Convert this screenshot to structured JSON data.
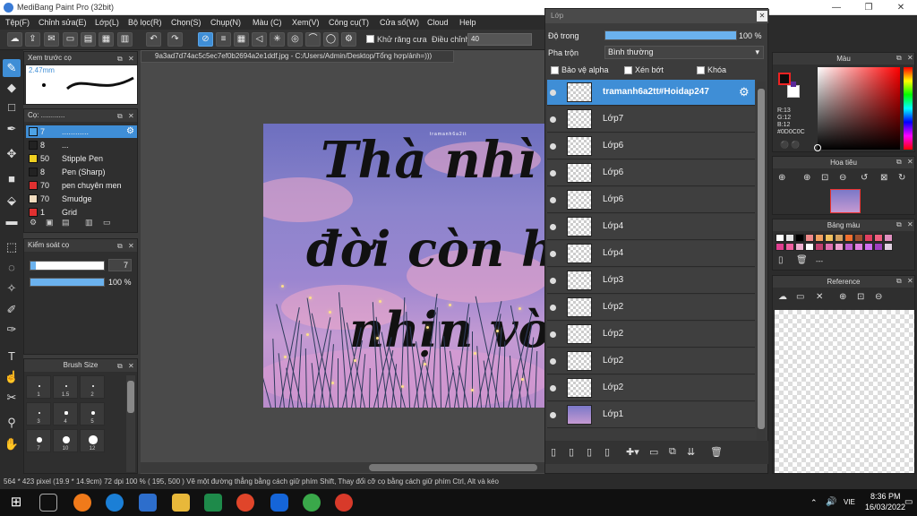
{
  "window": {
    "title": "MediBang Paint Pro (32bit)"
  },
  "menu": [
    "Tệp(F)",
    "Chỉnh sửa(E)",
    "Lớp(L)",
    "Bộ lọc(R)",
    "Chọn(S)",
    "Chụp(N)",
    "Màu (C)",
    "Xem(V)",
    "Công cụ(T)",
    "Cửa sổ(W)",
    "Cloud",
    "Help"
  ],
  "toolbar": {
    "antialias_label": "Khử răng cưa",
    "adjust_label": "Điều chỉnh",
    "adjust_value": "40"
  },
  "brush_preview": {
    "title": "Xem trước cọ",
    "size": "2.47mm"
  },
  "brush_list": {
    "title": "Cọ: ............",
    "items": [
      {
        "size": "7",
        "name": "............",
        "color": "#4da3e6",
        "selected": true
      },
      {
        "size": "8",
        "name": "...",
        "color": "#222222",
        "selected": false
      },
      {
        "size": "50",
        "name": "Stipple Pen",
        "color": "#f0d020",
        "selected": false
      },
      {
        "size": "8",
        "name": "Pen (Sharp)",
        "color": "#222222",
        "selected": false
      },
      {
        "size": "70",
        "name": "pen chuyên men",
        "color": "#e03030",
        "selected": false
      },
      {
        "size": "70",
        "name": "Smudge",
        "color": "#f0dcc0",
        "selected": false
      },
      {
        "size": "1",
        "name": "Grid",
        "color": "#e03030",
        "selected": false
      }
    ]
  },
  "brush_control": {
    "title": "Kiểm soát cọ",
    "size_value": "7",
    "opacity_value": "100 %",
    "size_fraction": 0.07,
    "opacity_fraction": 1.0
  },
  "brush_size": {
    "title": "Brush Size",
    "labels": [
      "1",
      "1.5",
      "2",
      "3",
      "4",
      "5",
      "7",
      "10",
      "12"
    ]
  },
  "document": {
    "tab": "9a3ad7d74ac5c5ec7ef0b2694a2e1ddf.jpg - C:/Users/Admin/Desktop/Tổng hợp/ảnh=)))"
  },
  "canvas_art": {
    "watermark": "tramanh6a2tt",
    "line1": "Thà nhì",
    "line2": "đời còn h",
    "line3": "nhịn vờ"
  },
  "layer_panel": {
    "title": "Lớp",
    "opacity_label": "Độ trong",
    "opacity_value": "100 %",
    "blend_label": "Pha trộn",
    "blend_value": "Bình thường",
    "protect_alpha": "Bảo vệ alpha",
    "clipping": "Xén bớt",
    "lock": "Khóa",
    "layers": [
      {
        "name": "tramanh6a2tt#Hoidap247",
        "selected": true
      },
      {
        "name": "Lớp7",
        "selected": false
      },
      {
        "name": "Lớp6",
        "selected": false
      },
      {
        "name": "Lớp6",
        "selected": false
      },
      {
        "name": "Lớp6",
        "selected": false
      },
      {
        "name": "Lớp4",
        "selected": false
      },
      {
        "name": "Lớp4",
        "selected": false
      },
      {
        "name": "Lớp3",
        "selected": false
      },
      {
        "name": "Lớp2",
        "selected": false
      },
      {
        "name": "Lớp2",
        "selected": false
      },
      {
        "name": "Lớp2",
        "selected": false
      },
      {
        "name": "Lớp2",
        "selected": false
      },
      {
        "name": "Lớp1",
        "selected": false
      }
    ]
  },
  "color_panel": {
    "title": "Màu",
    "r": "R:13",
    "g": "G:12",
    "b": "B:12",
    "hex": "#0D0C0C",
    "primary": "#0d0c0c",
    "secondary": "#ffffff"
  },
  "navigator": {
    "title": "Hoa tiêu"
  },
  "palette": {
    "title": "Bảng màu",
    "note": "---",
    "colors": [
      "#ffffff",
      "#e6e6e6",
      "#000000",
      "#f08a8a",
      "#f0a060",
      "#f0c060",
      "#d4a060",
      "#f07030",
      "#a05030",
      "#e04060",
      "#f06080",
      "#e090c0",
      "#e04090",
      "#f060a0",
      "#f0b0d0",
      "#ffffff",
      "#c04070",
      "#e070b0",
      "#f0a0d0",
      "#c060d0",
      "#e080e0",
      "#d070f0",
      "#a040c0",
      "#e0d0e0"
    ]
  },
  "reference": {
    "title": "Reference"
  },
  "status": {
    "text": "564 * 423 pixel   (19.9 * 14.9cm)   72 dpi   100 %   ( 195, 500 )   Vẽ một đường thẳng bằng cách giữ phím Shift, Thay đổi cỡ cọ bằng cách giữ phím Ctrl, Alt và kéo"
  },
  "taskbar": {
    "time": "8:36 PM",
    "date": "16/03/2022",
    "lang": "VIE"
  }
}
